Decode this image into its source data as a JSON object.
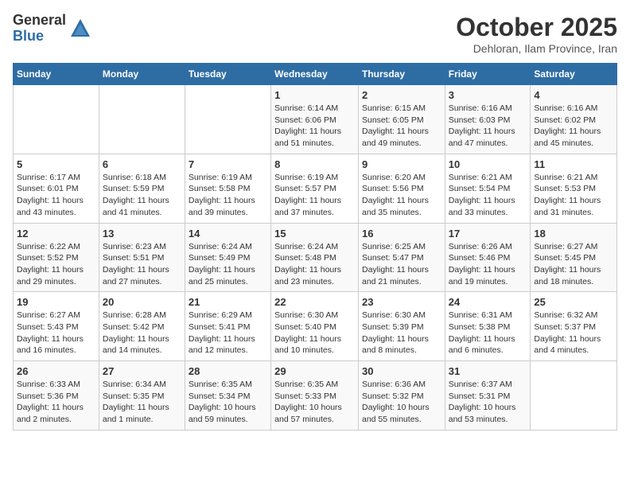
{
  "logo": {
    "general": "General",
    "blue": "Blue"
  },
  "header": {
    "month": "October 2025",
    "location": "Dehloran, Ilam Province, Iran"
  },
  "weekdays": [
    "Sunday",
    "Monday",
    "Tuesday",
    "Wednesday",
    "Thursday",
    "Friday",
    "Saturday"
  ],
  "weeks": [
    [
      {
        "day": "",
        "info": ""
      },
      {
        "day": "",
        "info": ""
      },
      {
        "day": "",
        "info": ""
      },
      {
        "day": "1",
        "info": "Sunrise: 6:14 AM\nSunset: 6:06 PM\nDaylight: 11 hours\nand 51 minutes."
      },
      {
        "day": "2",
        "info": "Sunrise: 6:15 AM\nSunset: 6:05 PM\nDaylight: 11 hours\nand 49 minutes."
      },
      {
        "day": "3",
        "info": "Sunrise: 6:16 AM\nSunset: 6:03 PM\nDaylight: 11 hours\nand 47 minutes."
      },
      {
        "day": "4",
        "info": "Sunrise: 6:16 AM\nSunset: 6:02 PM\nDaylight: 11 hours\nand 45 minutes."
      }
    ],
    [
      {
        "day": "5",
        "info": "Sunrise: 6:17 AM\nSunset: 6:01 PM\nDaylight: 11 hours\nand 43 minutes."
      },
      {
        "day": "6",
        "info": "Sunrise: 6:18 AM\nSunset: 5:59 PM\nDaylight: 11 hours\nand 41 minutes."
      },
      {
        "day": "7",
        "info": "Sunrise: 6:19 AM\nSunset: 5:58 PM\nDaylight: 11 hours\nand 39 minutes."
      },
      {
        "day": "8",
        "info": "Sunrise: 6:19 AM\nSunset: 5:57 PM\nDaylight: 11 hours\nand 37 minutes."
      },
      {
        "day": "9",
        "info": "Sunrise: 6:20 AM\nSunset: 5:56 PM\nDaylight: 11 hours\nand 35 minutes."
      },
      {
        "day": "10",
        "info": "Sunrise: 6:21 AM\nSunset: 5:54 PM\nDaylight: 11 hours\nand 33 minutes."
      },
      {
        "day": "11",
        "info": "Sunrise: 6:21 AM\nSunset: 5:53 PM\nDaylight: 11 hours\nand 31 minutes."
      }
    ],
    [
      {
        "day": "12",
        "info": "Sunrise: 6:22 AM\nSunset: 5:52 PM\nDaylight: 11 hours\nand 29 minutes."
      },
      {
        "day": "13",
        "info": "Sunrise: 6:23 AM\nSunset: 5:51 PM\nDaylight: 11 hours\nand 27 minutes."
      },
      {
        "day": "14",
        "info": "Sunrise: 6:24 AM\nSunset: 5:49 PM\nDaylight: 11 hours\nand 25 minutes."
      },
      {
        "day": "15",
        "info": "Sunrise: 6:24 AM\nSunset: 5:48 PM\nDaylight: 11 hours\nand 23 minutes."
      },
      {
        "day": "16",
        "info": "Sunrise: 6:25 AM\nSunset: 5:47 PM\nDaylight: 11 hours\nand 21 minutes."
      },
      {
        "day": "17",
        "info": "Sunrise: 6:26 AM\nSunset: 5:46 PM\nDaylight: 11 hours\nand 19 minutes."
      },
      {
        "day": "18",
        "info": "Sunrise: 6:27 AM\nSunset: 5:45 PM\nDaylight: 11 hours\nand 18 minutes."
      }
    ],
    [
      {
        "day": "19",
        "info": "Sunrise: 6:27 AM\nSunset: 5:43 PM\nDaylight: 11 hours\nand 16 minutes."
      },
      {
        "day": "20",
        "info": "Sunrise: 6:28 AM\nSunset: 5:42 PM\nDaylight: 11 hours\nand 14 minutes."
      },
      {
        "day": "21",
        "info": "Sunrise: 6:29 AM\nSunset: 5:41 PM\nDaylight: 11 hours\nand 12 minutes."
      },
      {
        "day": "22",
        "info": "Sunrise: 6:30 AM\nSunset: 5:40 PM\nDaylight: 11 hours\nand 10 minutes."
      },
      {
        "day": "23",
        "info": "Sunrise: 6:30 AM\nSunset: 5:39 PM\nDaylight: 11 hours\nand 8 minutes."
      },
      {
        "day": "24",
        "info": "Sunrise: 6:31 AM\nSunset: 5:38 PM\nDaylight: 11 hours\nand 6 minutes."
      },
      {
        "day": "25",
        "info": "Sunrise: 6:32 AM\nSunset: 5:37 PM\nDaylight: 11 hours\nand 4 minutes."
      }
    ],
    [
      {
        "day": "26",
        "info": "Sunrise: 6:33 AM\nSunset: 5:36 PM\nDaylight: 11 hours\nand 2 minutes."
      },
      {
        "day": "27",
        "info": "Sunrise: 6:34 AM\nSunset: 5:35 PM\nDaylight: 11 hours\nand 1 minute."
      },
      {
        "day": "28",
        "info": "Sunrise: 6:35 AM\nSunset: 5:34 PM\nDaylight: 10 hours\nand 59 minutes."
      },
      {
        "day": "29",
        "info": "Sunrise: 6:35 AM\nSunset: 5:33 PM\nDaylight: 10 hours\nand 57 minutes."
      },
      {
        "day": "30",
        "info": "Sunrise: 6:36 AM\nSunset: 5:32 PM\nDaylight: 10 hours\nand 55 minutes."
      },
      {
        "day": "31",
        "info": "Sunrise: 6:37 AM\nSunset: 5:31 PM\nDaylight: 10 hours\nand 53 minutes."
      },
      {
        "day": "",
        "info": ""
      }
    ]
  ]
}
